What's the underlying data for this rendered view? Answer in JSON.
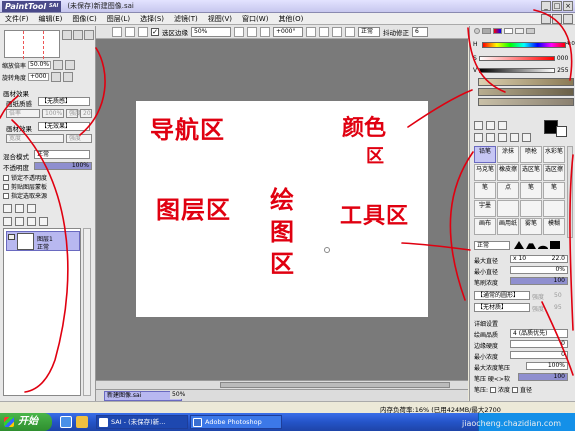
{
  "window": {
    "logo_text": "PaintTool",
    "logo_sub": "SAI",
    "title": "(未保存)新建图像.sai",
    "buttons": [
      "_",
      "□",
      "×"
    ]
  },
  "menu": {
    "items": [
      "文件(F)",
      "编辑(E)",
      "图像(C)",
      "图层(L)",
      "选择(S)",
      "滤镜(T)",
      "视图(V)",
      "窗口(W)",
      "其他(O)"
    ]
  },
  "toolbar": {
    "selection_edge_label": "选区边缘",
    "zoom_value": "50%",
    "rotation_value": "+000°",
    "mode_value": "正常",
    "stabilizer_label": "抖动修正",
    "stabilizer_value": "6"
  },
  "navigator": {
    "zoom_label": "缩放倍率",
    "zoom_value": "50.0%",
    "rotation_label": "旋转角度",
    "rotation_value": "+000"
  },
  "layer_panel": {
    "paper_effect_title": "画材效果",
    "paper_texture_label": "画纸质感",
    "paper_texture_value": "【无质感】",
    "paper_scale_label": "倍率",
    "paper_scale_value": "100%",
    "paper_strength_label": "强度",
    "paper_strength_value": "20",
    "material_effect_label": "画材效果",
    "material_effect_value": "【无效果】",
    "material_width_label": "宽度",
    "material_strength_label": "强度",
    "blend_mode_label": "混合模式",
    "blend_mode_value": "正常",
    "opacity_label": "不透明度",
    "opacity_value": "100%",
    "opacity_fraction": 1.0,
    "lock_opacity_label": "锁定不透明度",
    "clip_group_label": "剪贴图层蒙板",
    "selection_source_label": "指定选取来源",
    "layer_name": "图层1",
    "layer_mode": "正常",
    "layer_opacity": "100%"
  },
  "canvas": {
    "doc_tab_name": "新建图像.sai",
    "doc_tab_zoom": "50%"
  },
  "color_panel": {
    "h_label": "H",
    "h_value": "4:0",
    "s_label": "S",
    "s_value": "000",
    "v_label": "V",
    "v_value": "255"
  },
  "tools": {
    "cells": [
      "铅笔",
      "涂抹",
      "喷枪",
      "水彩笔",
      "马克笔",
      "橡皮擦",
      "选区笔",
      "选区擦",
      "笔",
      "点",
      "笔",
      "笔",
      "宇墨",
      "",
      "",
      "",
      "画布",
      "画用纸",
      "雾笔",
      "模糊"
    ],
    "active_index": 0,
    "brush_mode": "正常",
    "max_size_label": "最大直径",
    "max_size_multiplier": "x 10",
    "max_size_value": "22.0",
    "min_size_label": "最小直径",
    "min_size_value": "0%",
    "density_label": "笔刷浓度",
    "density_value": "100",
    "shape_label": "【通常的圆形】",
    "shape_strength_label": "强度",
    "shape_strength_value": "50",
    "texture_label": "【无材质】",
    "texture_strength_label": "强度",
    "texture_strength_value": "95",
    "detail_title": "详细设置",
    "quality_label": "绘画品质",
    "quality_value": "4 (品质优先)",
    "edge_label": "边缘硬度",
    "edge_value": "0",
    "min_density_label": "最小浓度",
    "min_density_value": "0",
    "max_pressure_label": "最大浓度笔压",
    "max_pressure_value": "100%",
    "pressure_hardness_label": "笔压 硬<>软",
    "pressure_hardness_value": "100",
    "pressure_label": "笔压:",
    "pressure_density": "浓度",
    "pressure_size": "直径"
  },
  "status": {
    "text": "内存负荷率:16% (已用424MB/最大2700"
  },
  "taskbar": {
    "start_label": "开始",
    "items": [
      "SAI - (未保存)新...",
      "Adobe Photoshop"
    ]
  },
  "watermark": "jiaocheng.chazidian.com",
  "annotations": {
    "nav": "导航区",
    "color_a": "颜色",
    "color_b": "区",
    "layer": "图层区",
    "draw_a": "绘",
    "draw_b": "图",
    "draw_c": "区",
    "tool": "工具区",
    "color": "#e00010"
  }
}
